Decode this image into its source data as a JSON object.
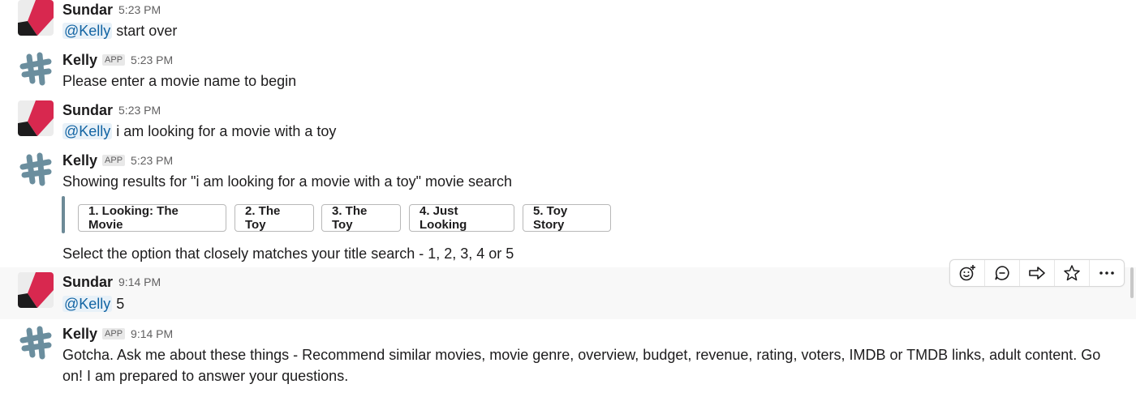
{
  "messages": [
    {
      "sender": "Sundar",
      "time": "5:23 PM",
      "mention": "@Kelly",
      "text": " start over"
    },
    {
      "sender": "Kelly",
      "badge": "APP",
      "time": "5:23 PM",
      "text": "Please enter a movie name to begin"
    },
    {
      "sender": "Sundar",
      "time": "5:23 PM",
      "mention": "@Kelly",
      "text": " i am looking for a movie with a toy"
    },
    {
      "sender": "Kelly",
      "badge": "APP",
      "time": "5:23 PM",
      "text": "Showing results for \"i am looking for a movie with a toy\" movie search",
      "options": [
        "1. Looking: The Movie",
        "2. The Toy",
        "3. The Toy",
        "4. Just Looking",
        "5. Toy Story"
      ],
      "footer": "Select the option that closely matches your title search - 1, 2, 3, 4 or 5"
    },
    {
      "sender": "Sundar",
      "time": "9:14 PM",
      "mention": "@Kelly",
      "text": " 5"
    },
    {
      "sender": "Kelly",
      "badge": "APP",
      "time": "9:14 PM",
      "text_line1": "Gotcha. Ask me about these things - Recommend similar movies, movie genre, overview, budget, revenue, rating, voters, IMDB or TMDB links, adult content. Go",
      "text_line2": "on! I am prepared to answer your questions."
    }
  ],
  "toolbar": {
    "icons": [
      "add-reaction-icon",
      "reply-thread-icon",
      "share-icon",
      "star-icon",
      "more-actions-icon"
    ]
  },
  "colors": {
    "mention_bg": "#e8f1f8",
    "mention_text": "#1264a3",
    "attachment_bar": "#6d8a97",
    "sundar_avatar_red": "#d8284f",
    "kelly_avatar_blue": "#6b8e9e"
  }
}
